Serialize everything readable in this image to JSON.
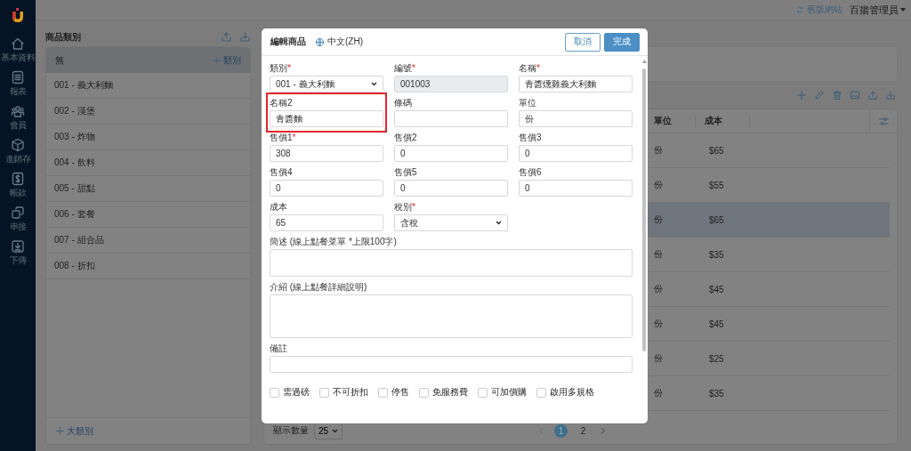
{
  "sidebar": {
    "items": [
      {
        "label": "基本資料"
      },
      {
        "label": "報表"
      },
      {
        "label": "會員"
      },
      {
        "label": "進銷存"
      },
      {
        "label": "帳款"
      },
      {
        "label": "串接"
      },
      {
        "label": "下傳"
      }
    ]
  },
  "topbar": {
    "old_site_link": "舊版網站",
    "user_menu": "百揚管理員"
  },
  "categories": {
    "title": "商品類別",
    "header": {
      "label": "無",
      "add_button": "類別"
    },
    "items": [
      {
        "label": "001 - 義大利麵"
      },
      {
        "label": "002 - 漢堡"
      },
      {
        "label": "003 - 炸物"
      },
      {
        "label": "004 - 飲料"
      },
      {
        "label": "005 - 甜點"
      },
      {
        "label": "006 - 套餐"
      },
      {
        "label": "007 - 組合品"
      },
      {
        "label": "008 - 折扣"
      }
    ],
    "add_main_button": "大類別"
  },
  "products_table": {
    "columns": [
      "單位",
      "成本"
    ],
    "rows": [
      {
        "cells": [
          "份",
          "$65"
        ],
        "selected": false
      },
      {
        "cells": [
          "份",
          "$55"
        ],
        "selected": false
      },
      {
        "cells": [
          "份",
          "$65"
        ],
        "selected": true
      },
      {
        "cells": [
          "份",
          "$35"
        ],
        "selected": false
      },
      {
        "cells": [
          "份",
          "$45"
        ],
        "selected": false
      },
      {
        "cells": [
          "份",
          "$45"
        ],
        "selected": false
      },
      {
        "cells": [
          "份",
          "$25"
        ],
        "selected": false
      },
      {
        "cells": [
          "份",
          "$35"
        ],
        "selected": false
      }
    ],
    "page_size_label": "顯示數量",
    "page_size": "25",
    "pages": [
      {
        "label": "1",
        "selected": true
      },
      {
        "label": "2",
        "selected": false
      }
    ]
  },
  "modal": {
    "title": "編輯商品",
    "language": "中文(ZH)",
    "cancel_button": "取消",
    "done_button": "完成",
    "fields": [
      {
        "kind": "select",
        "label": "類別",
        "mark": "*",
        "value": "001 - 義大利麵"
      },
      {
        "kind": "readonly",
        "label": "編號",
        "mark": "*",
        "value": "001003"
      },
      {
        "kind": "input",
        "label": "名稱",
        "mark": "*",
        "value": "青醬燻雞義大利麵"
      },
      {
        "kind": "input",
        "label": "名稱2",
        "value": "青醬麵",
        "highlighted": true
      },
      {
        "kind": "input",
        "label": "條碼"
      },
      {
        "kind": "input",
        "label": "單位",
        "value": "份"
      },
      {
        "kind": "input",
        "label": "售價1",
        "mark": "*",
        "value": "308"
      },
      {
        "kind": "input",
        "label": "售價2",
        "value": "0"
      },
      {
        "kind": "input",
        "label": "售價3",
        "value": "0"
      },
      {
        "kind": "input",
        "label": "售價4",
        "value": "0"
      },
      {
        "kind": "input",
        "label": "售價5",
        "value": "0"
      },
      {
        "kind": "input",
        "label": "售價6",
        "value": "0"
      },
      {
        "kind": "input",
        "label": "成本",
        "value": "65"
      },
      {
        "kind": "select",
        "label": "稅別",
        "mark": "*",
        "value": "含稅"
      },
      {
        "kind": "textarea",
        "label": "簡述 (線上點餐菜單 *上限100字)"
      },
      {
        "kind": "textarea_tall",
        "label": "介紹 (線上點餐詳細說明)"
      },
      {
        "kind": "wide",
        "label": "備註"
      }
    ],
    "checkboxes": [
      {
        "label": "需過磅",
        "checked": false
      },
      {
        "label": "不可折扣",
        "checked": false
      },
      {
        "label": "停售",
        "checked": false
      },
      {
        "label": "免服務費",
        "checked": false
      },
      {
        "label": "可加價購",
        "checked": false
      },
      {
        "label": "啟用多規格",
        "checked": false
      }
    ]
  }
}
